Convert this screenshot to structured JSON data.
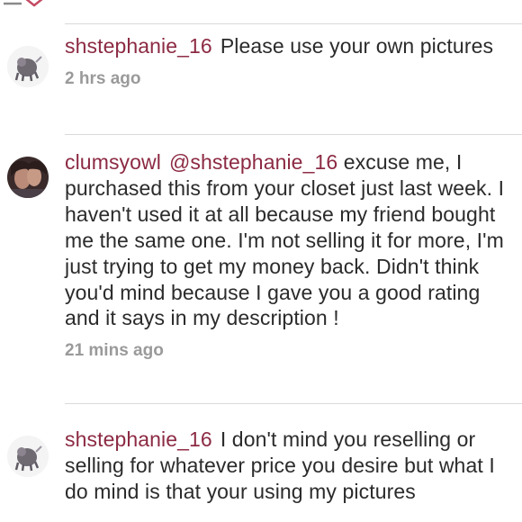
{
  "comments": [
    {
      "username": "shstephanie_16",
      "message": "Please use your own pictures",
      "time": "2 hrs ago"
    },
    {
      "username": "clumsyowl",
      "mention": "@shstephanie_16",
      "message": " excuse me, I purchased this from your closet just last week. I haven't used it  at all because my friend bought me the same one. I'm not selling it for more, I'm just trying to get my money back. Didn't think you'd mind because I gave you a good rating and it says in my description !",
      "time": "21 mins ago"
    },
    {
      "username": "shstephanie_16",
      "message": "I don't mind you reselling or selling for  whatever price you desire but what I do mind is that your using my pictures"
    }
  ],
  "colors": {
    "username": "#8c2a43",
    "text": "#2b2b2b",
    "timestamp": "#9a9a9a",
    "divider": "#d9d9d9"
  }
}
